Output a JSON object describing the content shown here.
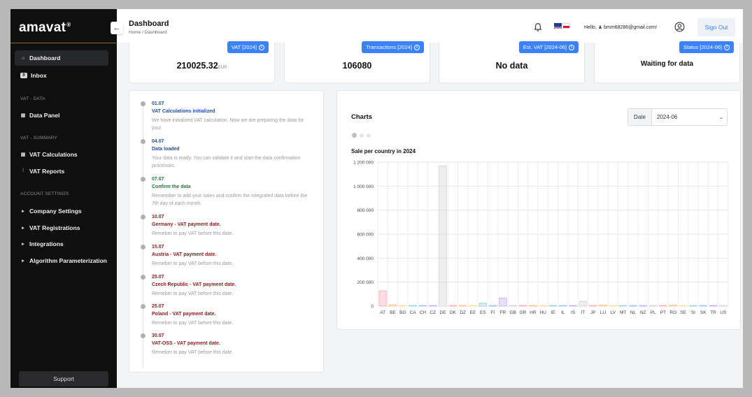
{
  "sidebar": {
    "brand": "amavat",
    "brand_mark": "®",
    "collapse_icon": "←",
    "items": [
      {
        "label": "Dashboard",
        "icon": "home-icon"
      },
      {
        "label": "Inbox",
        "icon": "inbox-icon",
        "badge": "0"
      }
    ],
    "sections": [
      {
        "title": "VAT - DATA",
        "items": [
          {
            "label": "Data Panel",
            "icon": "grid-icon"
          }
        ]
      },
      {
        "title": "VAT - SUMMARY",
        "items": [
          {
            "label": "VAT Calculations",
            "icon": "grid-icon"
          },
          {
            "label": "VAT Reports",
            "icon": "chart-icon"
          }
        ]
      },
      {
        "title": "ACCOUNT SETTINGS",
        "items": [
          {
            "label": "Company Settings"
          },
          {
            "label": "VAT Registrations"
          },
          {
            "label": "Integrations"
          },
          {
            "label": "Algorithm Parameterization"
          }
        ]
      }
    ],
    "support_label": "Support"
  },
  "header": {
    "title": "Dashboard",
    "breadcrumb": "Home / Dashboard",
    "greeting": "Hello,",
    "user_email": "bmm68286@gmail.com!",
    "signout_label": "Sign Out"
  },
  "stats": [
    {
      "badge": "VAT [2024]",
      "value": "210025.32",
      "unit": "EUR"
    },
    {
      "badge": "Transactions [2024]",
      "value": "106080",
      "unit": ""
    },
    {
      "badge": "Est. VAT [2024-06]",
      "value": "No data",
      "unit": ""
    },
    {
      "badge": "Status [2024-06]",
      "value": "Waiting for data",
      "unit": ""
    }
  ],
  "timeline": [
    {
      "date": "01.07",
      "title": "VAT Calculations initialized",
      "desc": "We have initialized VAT calculation. Now we are preparing the data for you!",
      "color": "blue"
    },
    {
      "date": "04.07",
      "title": "Data loaded",
      "desc": "Your data is ready. You can validate it and start the data confirmation processes.",
      "color": "blue"
    },
    {
      "date": "07.07",
      "title": "Confirm the data",
      "desc": "Remember to add your sales and confirm the integrated data before the 7th day of each month.",
      "color": "green"
    },
    {
      "date": "10.07",
      "title": "Germany - VAT payment date.",
      "desc": "Remeber to pay VAT before this date.",
      "color": "red"
    },
    {
      "date": "15.07",
      "title": "Austria - VAT payment date.",
      "desc": "Remeber to pay VAT before this date.",
      "color": "red"
    },
    {
      "date": "25.07",
      "title": "Czech Republic - VAT payment date.",
      "desc": "Remeber to pay VAT before this date.",
      "color": "red"
    },
    {
      "date": "25.07",
      "title": "Poland - VAT payment date.",
      "desc": "Remeber to pay VAT before this date.",
      "color": "red"
    },
    {
      "date": "30.07",
      "title": "VAT-OSS - VAT payment date.",
      "desc": "Remeber to pay VAT before this date.",
      "color": "red"
    }
  ],
  "charts": {
    "title": "Charts",
    "date_label": "Date",
    "date_value": "2024-06",
    "carousel_pages": 3,
    "carousel_active": 0
  },
  "chart_data": {
    "type": "bar",
    "title": "Sale per country in 2024",
    "categories": [
      "AT",
      "BE",
      "BG",
      "CA",
      "CH",
      "CZ",
      "DE",
      "DK",
      "DZ",
      "EE",
      "ES",
      "FI",
      "FR",
      "GB",
      "GR",
      "HR",
      "HU",
      "IE",
      "IL",
      "IS",
      "IT",
      "JP",
      "LU",
      "LV",
      "MT",
      "NL",
      "NZ",
      "PL",
      "PT",
      "RO",
      "SE",
      "SI",
      "SK",
      "TR",
      "US"
    ],
    "values": [
      128000,
      12000,
      3000,
      2000,
      3000,
      4000,
      1170000,
      4000,
      1000,
      2000,
      25000,
      3000,
      68000,
      4000,
      2000,
      2000,
      3000,
      3000,
      2000,
      2000,
      40000,
      4000,
      10000,
      2000,
      2000,
      2000,
      2000,
      2000,
      2000,
      8000,
      2000,
      5000,
      2000,
      4000,
      2000
    ],
    "colors": [
      "#f9b4c2",
      "#f9c99a",
      "#f5e3a8",
      "#a7d8d8",
      "#a8c8f0",
      "#cdb8f5",
      "#d9d9d9",
      "#f9b4c2",
      "#f9c99a",
      "#f5e3a8",
      "#a7d8d8",
      "#a8c8f0",
      "#cdb8f5",
      "#d9d9d9",
      "#f9b4c2",
      "#f9c99a",
      "#f5e3a8",
      "#a7d8d8",
      "#a8c8f0",
      "#cdb8f5",
      "#d9d9d9",
      "#f9b4c2",
      "#f9c99a",
      "#f5e3a8",
      "#a7d8d8",
      "#a8c8f0",
      "#cdb8f5",
      "#d9d9d9",
      "#f9b4c2",
      "#f9c99a",
      "#f5e3a8",
      "#a7d8d8",
      "#a8c8f0",
      "#cdb8f5",
      "#d9d9d9"
    ],
    "y_ticks": [
      "0",
      "200 000",
      "400 000",
      "600 000",
      "800 000",
      "1 000 000",
      "1 200 000"
    ],
    "ylim": [
      0,
      1200000
    ],
    "grid": true
  }
}
